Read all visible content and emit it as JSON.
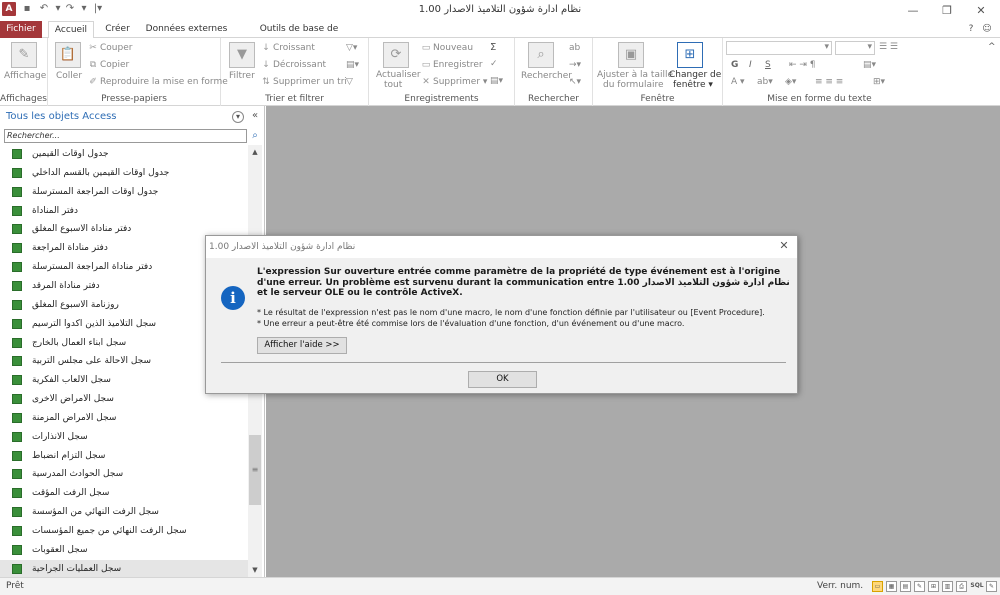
{
  "window": {
    "title": "نظام ادارة شؤون التلاميذ الاصدار 1.00"
  },
  "tabs": {
    "file": "Fichier",
    "home": "Accueil",
    "create": "Créer",
    "external": "Données externes",
    "dbtools": "Outils de base de données"
  },
  "ribbon": {
    "views": {
      "view": "Affichage",
      "label": "Affichages"
    },
    "clipboard": {
      "paste": "Coller",
      "cut": "Couper",
      "copy": "Copier",
      "format_painter": "Reproduire la mise en forme",
      "label": "Presse-papiers"
    },
    "sort": {
      "filter": "Filtrer",
      "ascending": "Croissant",
      "descending": "Décroissant",
      "remove_sort": "Supprimer un tri",
      "label": "Trier et filtrer"
    },
    "records": {
      "refresh": "Actualiser",
      "refresh_sub": "tout",
      "new": "Nouveau",
      "save": "Enregistrer",
      "delete": "Supprimer",
      "label": "Enregistrements"
    },
    "find": {
      "find": "Rechercher",
      "label": "Rechercher"
    },
    "window": {
      "fit": "Ajuster à la taille",
      "fit_sub": "du formulaire",
      "switch": "Changer de",
      "switch_sub": "fenêtre",
      "label": "Fenêtre"
    },
    "text_format": {
      "bold": "G",
      "italic": "I",
      "underline": "S",
      "label": "Mise en forme du texte"
    }
  },
  "nav": {
    "title": "Tous les objets Access",
    "search_placeholder": "Rechercher...",
    "items": [
      {
        "label": "جدول اوقات القيمين"
      },
      {
        "label": "جدول اوقات القيمين بالقسم الداخلي"
      },
      {
        "label": "جدول اوقات المراجعة المسترسلة"
      },
      {
        "label": "دفتر المناداة"
      },
      {
        "label": "دفتر مناداة الاسبوع المغلق"
      },
      {
        "label": "دفتر مناداة المراجعة"
      },
      {
        "label": "دفتر مناداة المراجعة المسترسلة"
      },
      {
        "label": "دفتر مناداة المرقد"
      },
      {
        "label": "روزنامة الاسبوع المغلق"
      },
      {
        "label": "سجل التلاميذ الذين اكدوا الترسيم"
      },
      {
        "label": "سجل ابناء العمال بالخارج"
      },
      {
        "label": "سجل الاحالة على مجلس التربية"
      },
      {
        "label": "سجل الالعاب الفكرية"
      },
      {
        "label": "سجل الامراض الاخرى"
      },
      {
        "label": "سجل الامراض المزمنة"
      },
      {
        "label": "سجل الانذارات"
      },
      {
        "label": "سجل التزام انضباط"
      },
      {
        "label": "سجل الحوادث المدرسية"
      },
      {
        "label": "سجل الرفت المؤقت"
      },
      {
        "label": "سجل الرفت النهائي من المؤسسة"
      },
      {
        "label": "سجل الرفت النهائي من جميع المؤسسات"
      },
      {
        "label": "سجل العقوبات"
      },
      {
        "label": "سجل العمليات الجراحية"
      }
    ]
  },
  "dialog": {
    "title": "نظام ادارة شؤون التلاميذ الاصدار 1.00",
    "message": "L'expression Sur ouverture entrée comme paramètre de la propriété de type événement est à l'origine d'une erreur. Un problème est survenu durant la communication entre نظام ادارة شؤون التلاميذ الاصدار 1.00 et le serveur OLE ou le contrôle ActiveX.",
    "detail1": "* Le résultat de l'expression n'est pas le nom d'une macro, le nom d'une fonction définie par l'utilisateur ou [Event Procedure].",
    "detail2": "* Une erreur a peut-être été commise lors de l'évaluation d'une fonction, d'un événement ou d'une macro.",
    "help_button": "Afficher l'aide >>",
    "ok_button": "OK"
  },
  "status": {
    "left": "Prêt",
    "numlock": "Verr. num."
  }
}
